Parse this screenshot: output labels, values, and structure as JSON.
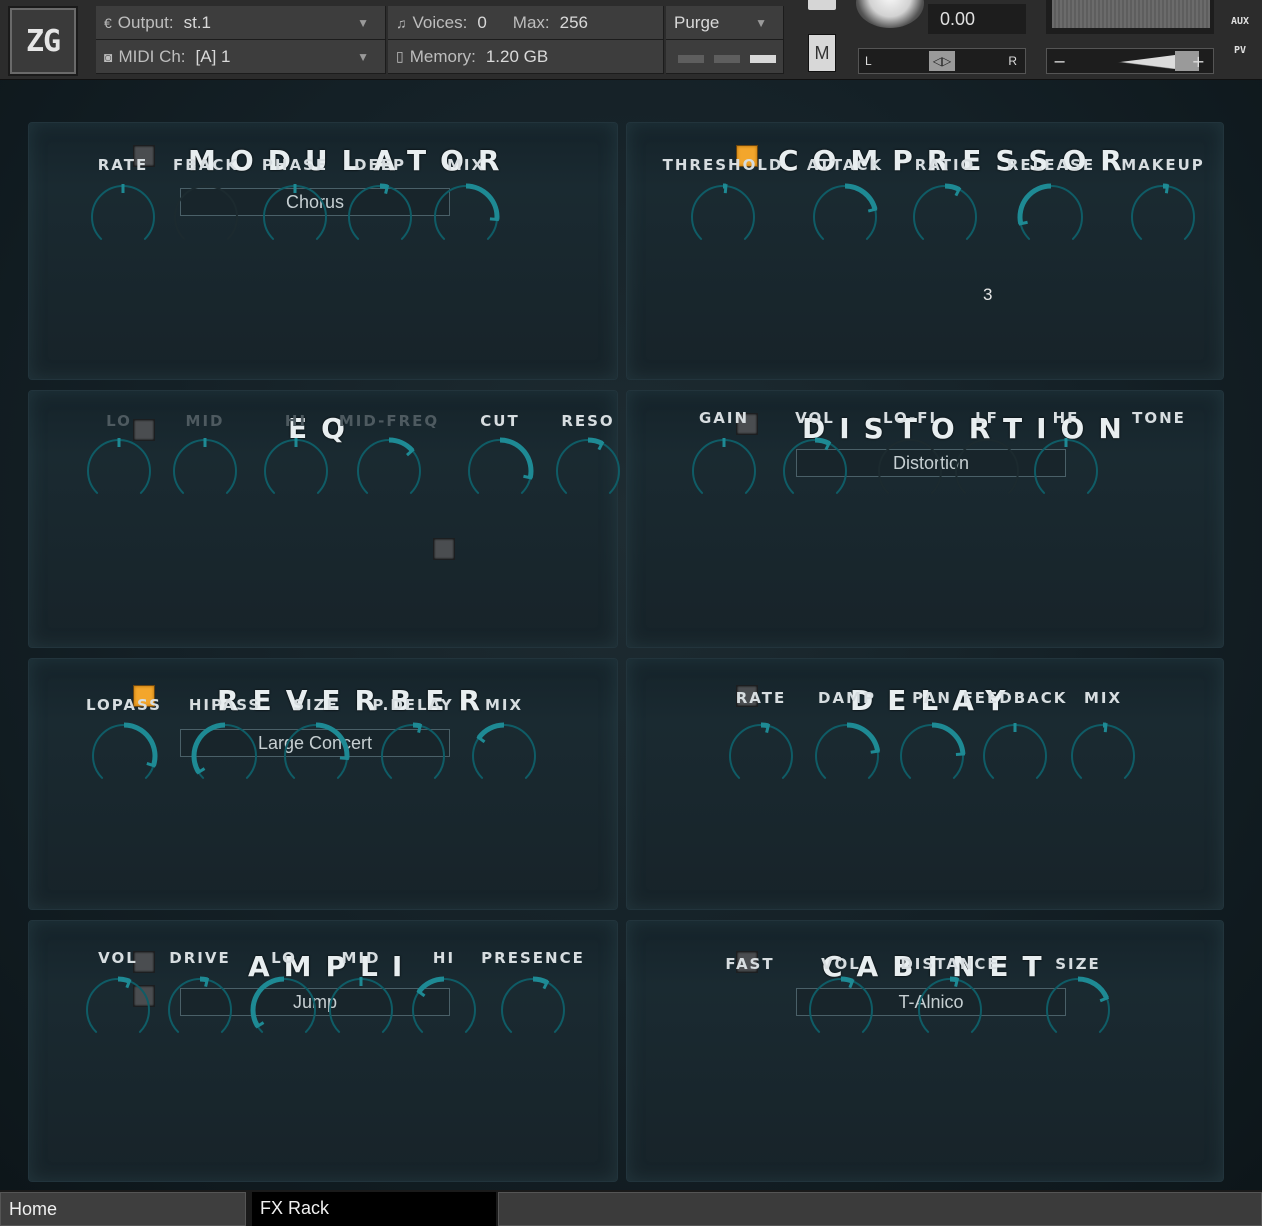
{
  "header": {
    "logo": "ZG",
    "output": {
      "label": "Output:",
      "value": "st.1"
    },
    "midi": {
      "label": "MIDI Ch:",
      "value": "[A]  1"
    },
    "voices": {
      "label": "Voices:",
      "value": "0",
      "max_label": "Max:",
      "max_value": "256"
    },
    "memory": {
      "label": "Memory:",
      "value": "1.20 GB"
    },
    "purge": "Purge",
    "mute": "M",
    "tune_value": "0.00",
    "pan_left": "L",
    "pan_right": "R",
    "vol_minus": "−",
    "vol_plus": "+",
    "aux": "AUX",
    "pv": "PV"
  },
  "colors": {
    "accent": "#1e8a94",
    "toggle_on": "#f3a62c",
    "toggle_off": "#4a4d50"
  },
  "modules": {
    "modulator": {
      "title": "MODULATOR",
      "enabled": false,
      "preset": "Chorus",
      "knobs": [
        {
          "label": "RATE",
          "value": 0.5
        },
        {
          "label": "FBACK",
          "value": 0,
          "disabled": true
        },
        {
          "label": "PHASE",
          "value": 0.5
        },
        {
          "label": "DEEP",
          "value": 0.55
        },
        {
          "label": "MIX",
          "value": 0.85
        }
      ]
    },
    "compressor": {
      "title": "COMPRESSOR",
      "enabled": true,
      "knobs": [
        {
          "label": "THRESHOLD",
          "value": 0.52
        },
        {
          "label": "ATTACK",
          "value": 0.78
        },
        {
          "label": "RATIO",
          "value": 0.6,
          "readout": "3"
        },
        {
          "label": "RELEASE",
          "value": 0.12
        },
        {
          "label": "MAKEUP",
          "value": 0.53
        }
      ]
    },
    "eq": {
      "title": "EQ",
      "enabled": false,
      "knobs": [
        {
          "label": "LO",
          "value": 0.5,
          "dim": true
        },
        {
          "label": "MID",
          "value": 0.5,
          "dim": true
        },
        {
          "label": "HI",
          "value": 0.5,
          "dim": true
        },
        {
          "label": "MID-FREQ",
          "value": 0.68,
          "dim": true
        },
        {
          "label": "CUT",
          "value": 0.88
        },
        {
          "label": "RESO",
          "value": 0.6
        }
      ]
    },
    "distortion": {
      "title": "DISTORTION",
      "enabled": false,
      "preset": "Distortion",
      "knobs": [
        {
          "label": "GAIN",
          "value": 0.5
        },
        {
          "label": "VOL",
          "value": 0.6
        },
        {
          "label": "LO-FI",
          "value": 0,
          "disabled": true
        },
        {
          "label": "LF",
          "value": 0,
          "disabled": true
        },
        {
          "label": "HF",
          "value": 0.5
        },
        {
          "label": "TONE",
          "value": 0,
          "hidden": true
        }
      ]
    },
    "reverber": {
      "title": "REVERBER",
      "enabled": true,
      "preset": "Large Concert",
      "knobs": [
        {
          "label": "LOPASS",
          "value": 0.9
        },
        {
          "label": "HIPASS",
          "value": 0.05
        },
        {
          "label": "SIZE",
          "value": 0.85
        },
        {
          "label": "P.DELAY",
          "value": 0.55
        },
        {
          "label": "MIX",
          "value": 0.3
        }
      ]
    },
    "delay": {
      "title": "DELAY",
      "enabled": false,
      "knobs": [
        {
          "label": "RATE",
          "value": 0.55
        },
        {
          "label": "DAMP",
          "value": 0.8
        },
        {
          "label": "PAN",
          "value": 0.82
        },
        {
          "label": "FEEDBACK",
          "value": 0.5
        },
        {
          "label": "MIX",
          "value": 0.52
        }
      ]
    },
    "ampli": {
      "title": "AMPLI",
      "enabled": false,
      "enabled2": false,
      "preset": "Jump",
      "knobs": [
        {
          "label": "VOL",
          "value": 0.58
        },
        {
          "label": "DRIVE",
          "value": 0.55
        },
        {
          "label": "LO",
          "value": 0.05
        },
        {
          "label": "MID",
          "value": 0.5
        },
        {
          "label": "HI",
          "value": 0.3
        },
        {
          "label": "PRESENCE",
          "value": 0.6
        }
      ]
    },
    "cabinet": {
      "title": "CABINET",
      "enabled": false,
      "preset": "T-Alnico",
      "knobs": [
        {
          "label": "FAST",
          "value": 0,
          "hidden": true
        },
        {
          "label": "VOL",
          "value": 0.58
        },
        {
          "label": "DISTANCE",
          "value": 0.55
        },
        {
          "label": "SIZE",
          "value": 0.75
        }
      ]
    }
  },
  "tabs": [
    {
      "label": "Home",
      "active": false
    },
    {
      "label": "FX Rack",
      "active": true
    }
  ]
}
